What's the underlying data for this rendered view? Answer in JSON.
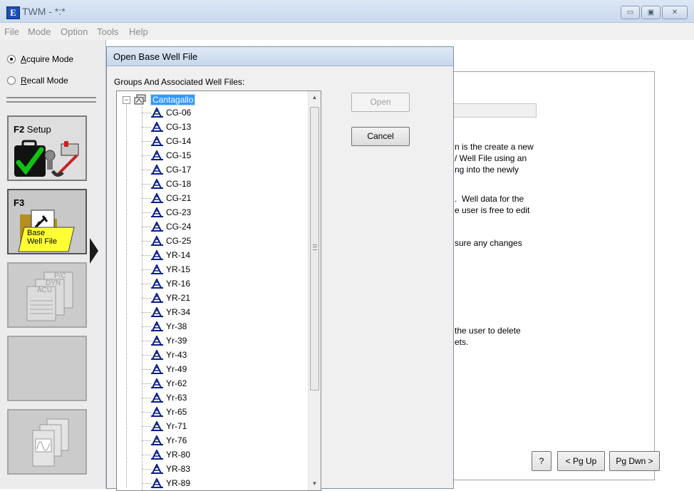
{
  "window": {
    "title": "TWM - *:*",
    "app_icon_letter": "E"
  },
  "window_buttons": {
    "minimize": "▭",
    "maximize": "▣",
    "close": "✕"
  },
  "menu": [
    "File",
    "Mode",
    "Option",
    "Tools",
    "Help"
  ],
  "modes": {
    "acquire": {
      "accel": "A",
      "rest": "cquire Mode",
      "selected": true
    },
    "recall": {
      "accel": "R",
      "rest": "ecall Mode",
      "selected": false
    }
  },
  "tiles": {
    "setup": {
      "fkey": "F2",
      "label": "Setup"
    },
    "base": {
      "fkey": "F3",
      "label_line1": "Base",
      "label_line2": "Well File"
    },
    "reports": {
      "lines": [
        "P/C",
        "DYN",
        "ACU"
      ]
    }
  },
  "dialog": {
    "title": "Open Base Well File",
    "groups_label": "Groups And Associated Well Files:",
    "root": "Cantagallo",
    "expander": "−",
    "items": [
      "CG-06",
      "CG-13",
      "CG-14",
      "CG-15",
      "CG-17",
      "CG-18",
      "CG-21",
      "CG-23",
      "CG-24",
      "CG-25",
      "YR-14",
      "YR-15",
      "YR-16",
      "YR-21",
      "YR-34",
      "Yr-38",
      "Yr-39",
      "Yr-43",
      "Yr-49",
      "Yr-62",
      "Yr-63",
      "Yr-65",
      "Yr-71",
      "Yr-76",
      "YR-80",
      "YR-83",
      "YR-89"
    ],
    "open_label": "Open",
    "cancel_label": "Cancel",
    "scroll_up": "▲",
    "scroll_down": "▼"
  },
  "background_text": {
    "p1": [
      "n is the create a new",
      "/ Well File using an",
      "ng into the newly"
    ],
    "p2": [
      ".  Well data for the",
      "e user is free to edit"
    ],
    "p3": [
      "sure any changes"
    ],
    "p4": [
      "the user to delete",
      "ets."
    ]
  },
  "nav": {
    "help": "?",
    "pg_up": "< Pg Up",
    "pg_down": "Pg Dwn >"
  }
}
